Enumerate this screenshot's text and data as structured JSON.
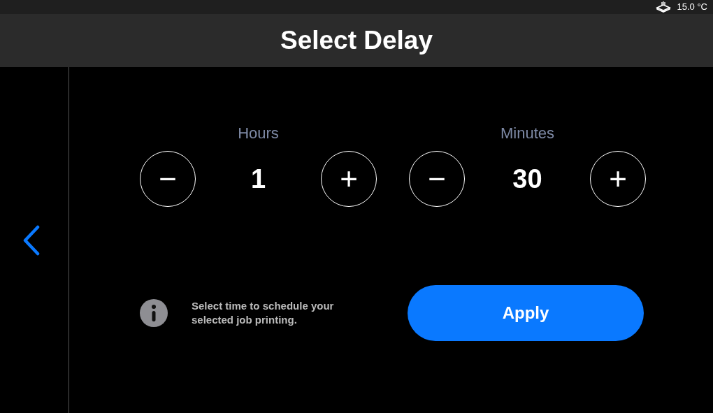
{
  "status_bar": {
    "temperature": "15.0 °C"
  },
  "header": {
    "title": "Select Delay"
  },
  "steppers": [
    {
      "label": "Hours",
      "value": "1",
      "minus": "−",
      "plus": "+"
    },
    {
      "label": "Minutes",
      "value": "30",
      "minus": "−",
      "plus": "+"
    }
  ],
  "info": {
    "text": "Select time to schedule your selected job printing."
  },
  "apply_button": {
    "label": "Apply"
  }
}
